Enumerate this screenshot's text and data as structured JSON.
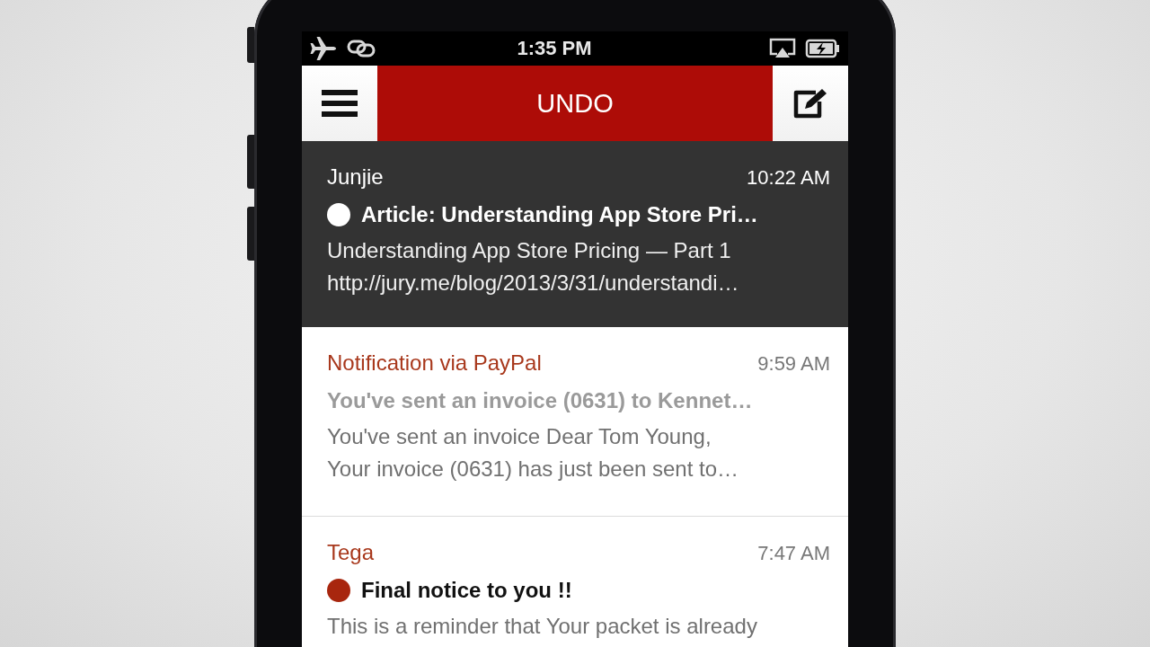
{
  "status_bar": {
    "time": "1:35 PM"
  },
  "nav_bar": {
    "title": "UNDO"
  },
  "messages": [
    {
      "sender": "Junjie",
      "time": "10:22 AM",
      "subject": "Article: Understanding App Store Pri…",
      "unread": true,
      "selected": true,
      "preview": [
        "Understanding App Store Pricing — Part 1",
        "http://jury.me/blog/2013/3/31/understandi…"
      ]
    },
    {
      "sender": "Notification via PayPal",
      "time": "9:59 AM",
      "subject": "You've sent an invoice (0631) to Kennet…",
      "unread": false,
      "selected": false,
      "preview": [
        "You've sent an invoice Dear Tom Young,",
        "Your invoice (0631) has just been sent to…"
      ]
    },
    {
      "sender": "Tega",
      "time": "7:47 AM",
      "subject": "Final notice to you !!",
      "unread": true,
      "selected": false,
      "preview": [
        "This is a reminder that Your packet is already"
      ]
    }
  ]
}
